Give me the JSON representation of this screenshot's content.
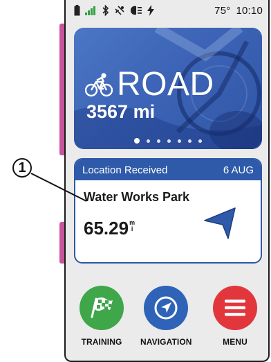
{
  "statusbar": {
    "temperature": "75°",
    "time": "10:10",
    "icons": [
      "battery-icon",
      "signal-icon",
      "bluetooth-icon",
      "gps-icon",
      "light-icon",
      "charging-icon"
    ]
  },
  "ride_card": {
    "title": "ROAD",
    "distance": "3567 mi",
    "icon": "bicycle-icon",
    "page_count": 7,
    "active_page": 1,
    "bg_color": "#3d64b6"
  },
  "location_card": {
    "header": "Location Received",
    "date": "6 AUG",
    "name": "Water Works Park",
    "distance_value": "65.29",
    "distance_unit_top": "m",
    "distance_unit_bottom": "i",
    "arrow_icon": "direction-arrow-icon"
  },
  "buttons": [
    {
      "label": "TRAINING",
      "icon": "checkered-flag-icon",
      "color": "#3fa64a"
    },
    {
      "label": "NAVIGATION",
      "icon": "compass-icon",
      "color": "#2f63b8"
    },
    {
      "label": "MENU",
      "icon": "menu-icon",
      "color": "#e2363d"
    }
  ],
  "callout": {
    "number": "1"
  }
}
